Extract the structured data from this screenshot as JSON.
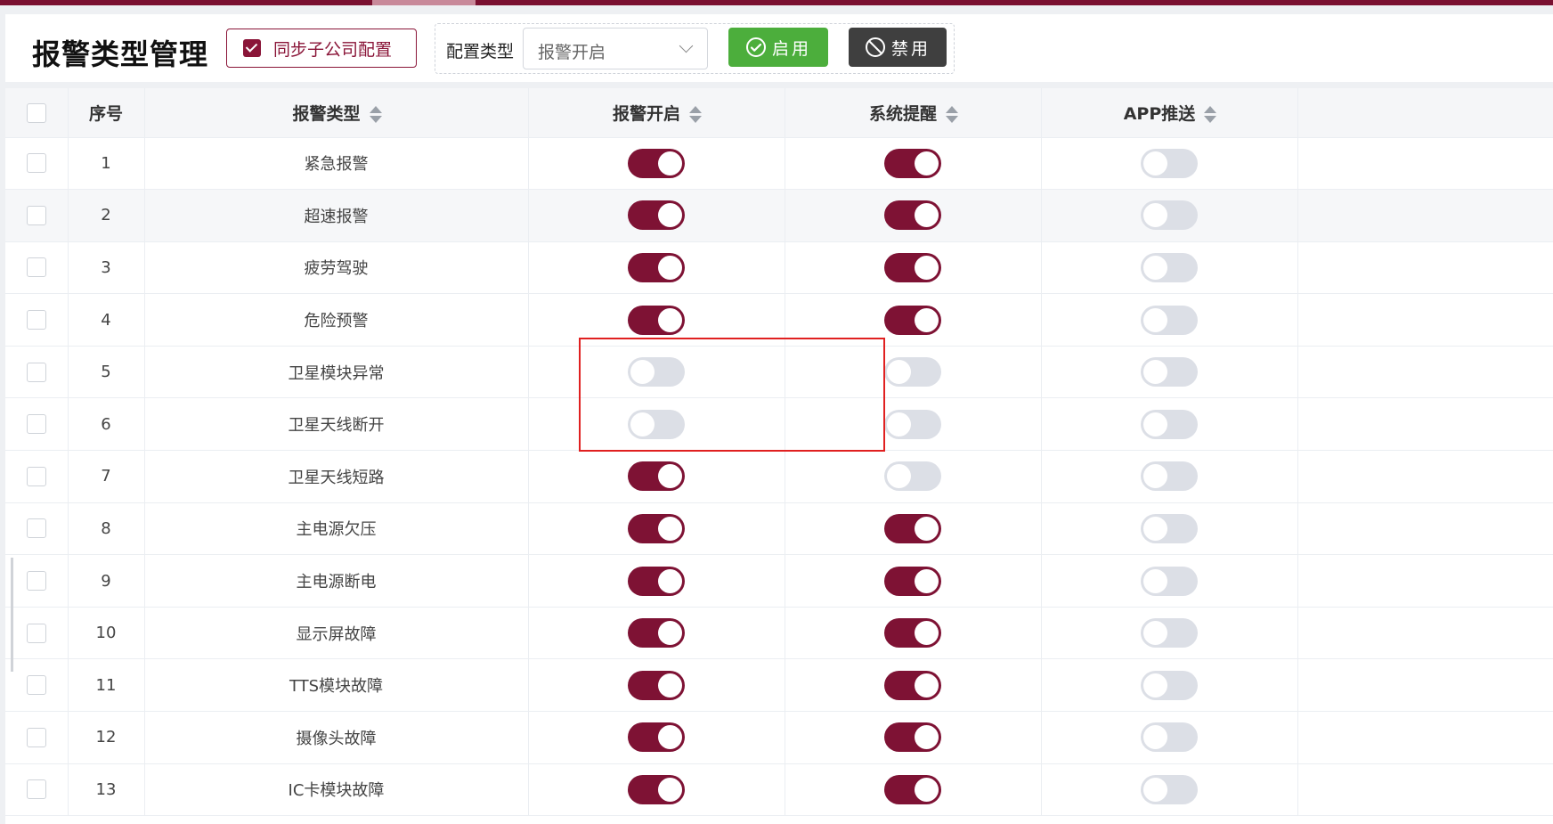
{
  "header": {
    "title": "报警类型管理",
    "sync_label": "同步子公司配置",
    "config_label": "配置类型",
    "config_value": "报警开启",
    "enable_label": "启用",
    "disable_label": "禁用"
  },
  "table": {
    "columns": [
      "",
      "序号",
      "报警类型",
      "报警开启",
      "系统提醒",
      "APP推送"
    ],
    "rows": [
      {
        "no": "1",
        "type": "紧急报警",
        "alarm": true,
        "system": true,
        "app": false
      },
      {
        "no": "2",
        "type": "超速报警",
        "alarm": true,
        "system": true,
        "app": false
      },
      {
        "no": "3",
        "type": "疲劳驾驶",
        "alarm": true,
        "system": true,
        "app": false
      },
      {
        "no": "4",
        "type": "危险预警",
        "alarm": true,
        "system": true,
        "app": false
      },
      {
        "no": "5",
        "type": "卫星模块异常",
        "alarm": false,
        "system": false,
        "app": false
      },
      {
        "no": "6",
        "type": "卫星天线断开",
        "alarm": false,
        "system": false,
        "app": false
      },
      {
        "no": "7",
        "type": "卫星天线短路",
        "alarm": true,
        "system": false,
        "app": false
      },
      {
        "no": "8",
        "type": "主电源欠压",
        "alarm": true,
        "system": true,
        "app": false
      },
      {
        "no": "9",
        "type": "主电源断电",
        "alarm": true,
        "system": true,
        "app": false
      },
      {
        "no": "10",
        "type": "显示屏故障",
        "alarm": true,
        "system": true,
        "app": false
      },
      {
        "no": "11",
        "type": "TTS模块故障",
        "alarm": true,
        "system": true,
        "app": false
      },
      {
        "no": "12",
        "type": "摄像头故障",
        "alarm": true,
        "system": true,
        "app": false
      },
      {
        "no": "13",
        "type": "IC卡模块故障",
        "alarm": true,
        "system": true,
        "app": false
      }
    ]
  },
  "colors": {
    "brand": "#7e1234",
    "enable": "#4cae3c",
    "disable": "#3f3f3f",
    "highlight": "#e02020",
    "switch_off": "#dcdfe6"
  }
}
